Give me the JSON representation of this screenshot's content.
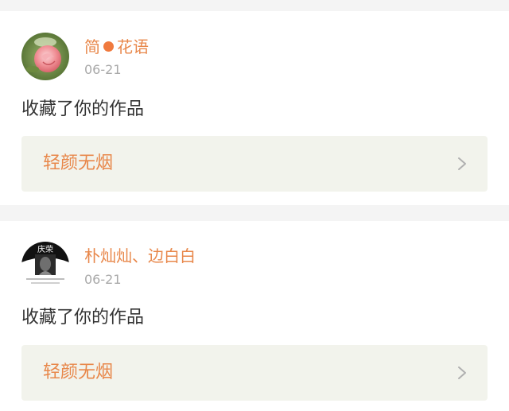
{
  "notifications": [
    {
      "user_first": "简",
      "user_second": "花语",
      "date": "06-21",
      "action": "收藏了你的作品",
      "work_title": "轻颜无烟",
      "colors": {
        "name": "#e8874a",
        "separator_dot": "#f07a3e"
      },
      "avatar_icon": "pink-rose-avatar"
    },
    {
      "users": "朴灿灿、边白白",
      "date": "06-21",
      "action": "收藏了你的作品",
      "work_title": "轻颜无烟",
      "avatar_icon": "portrait-avatar",
      "avatar_text": "庆荣"
    }
  ],
  "colors": {
    "accent": "#e8874a",
    "work_box_bg": "#f2f3ec",
    "text": "#333333",
    "muted": "#a9a9a9",
    "page_bg": "#f4f4f4"
  }
}
